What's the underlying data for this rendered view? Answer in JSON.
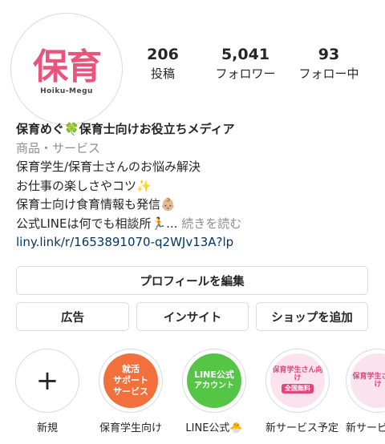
{
  "profile": {
    "logo_main": "保育",
    "logo_sub": "Hoiku-Megu",
    "stats": {
      "posts": {
        "value": "206",
        "label": "投稿"
      },
      "followers": {
        "value": "5,041",
        "label": "フォロワー"
      },
      "following": {
        "value": "93",
        "label": "フォロー中"
      }
    },
    "bio": {
      "name": "保育めぐ🍀保育士向けお役立ちメディア",
      "category": "商品・サービス",
      "lines": [
        "保育学生/保育士さんのお悩み解決",
        "お仕事の楽しさやコツ✨",
        "保育士向け食育情報も発信👶🏼",
        "公式LINEは何でも相談所🏃..."
      ],
      "more": "続きを読む",
      "link": "liny.link/r/1653891070-q2WJv13A?lp"
    }
  },
  "buttons": {
    "edit_profile": "プロフィールを編集",
    "ads": "広告",
    "insights": "インサイト",
    "add_shop": "ショップを追加"
  },
  "highlights": [
    {
      "label": "新規",
      "icon": "plus-icon"
    },
    {
      "label": "保育学生向け",
      "lines": [
        "就活",
        "サポート",
        "サービス"
      ],
      "color": "#f1703c"
    },
    {
      "label": "LINE公式🐣",
      "lines": [
        "LINE公式",
        "アカウント"
      ],
      "color": "#55c545"
    },
    {
      "label": "新サービス予定",
      "lines": [
        "保育学生さん向け",
        "全国無料"
      ]
    },
    {
      "label": "新サービ",
      "lines": [
        "保育学生さん向け"
      ]
    }
  ]
}
